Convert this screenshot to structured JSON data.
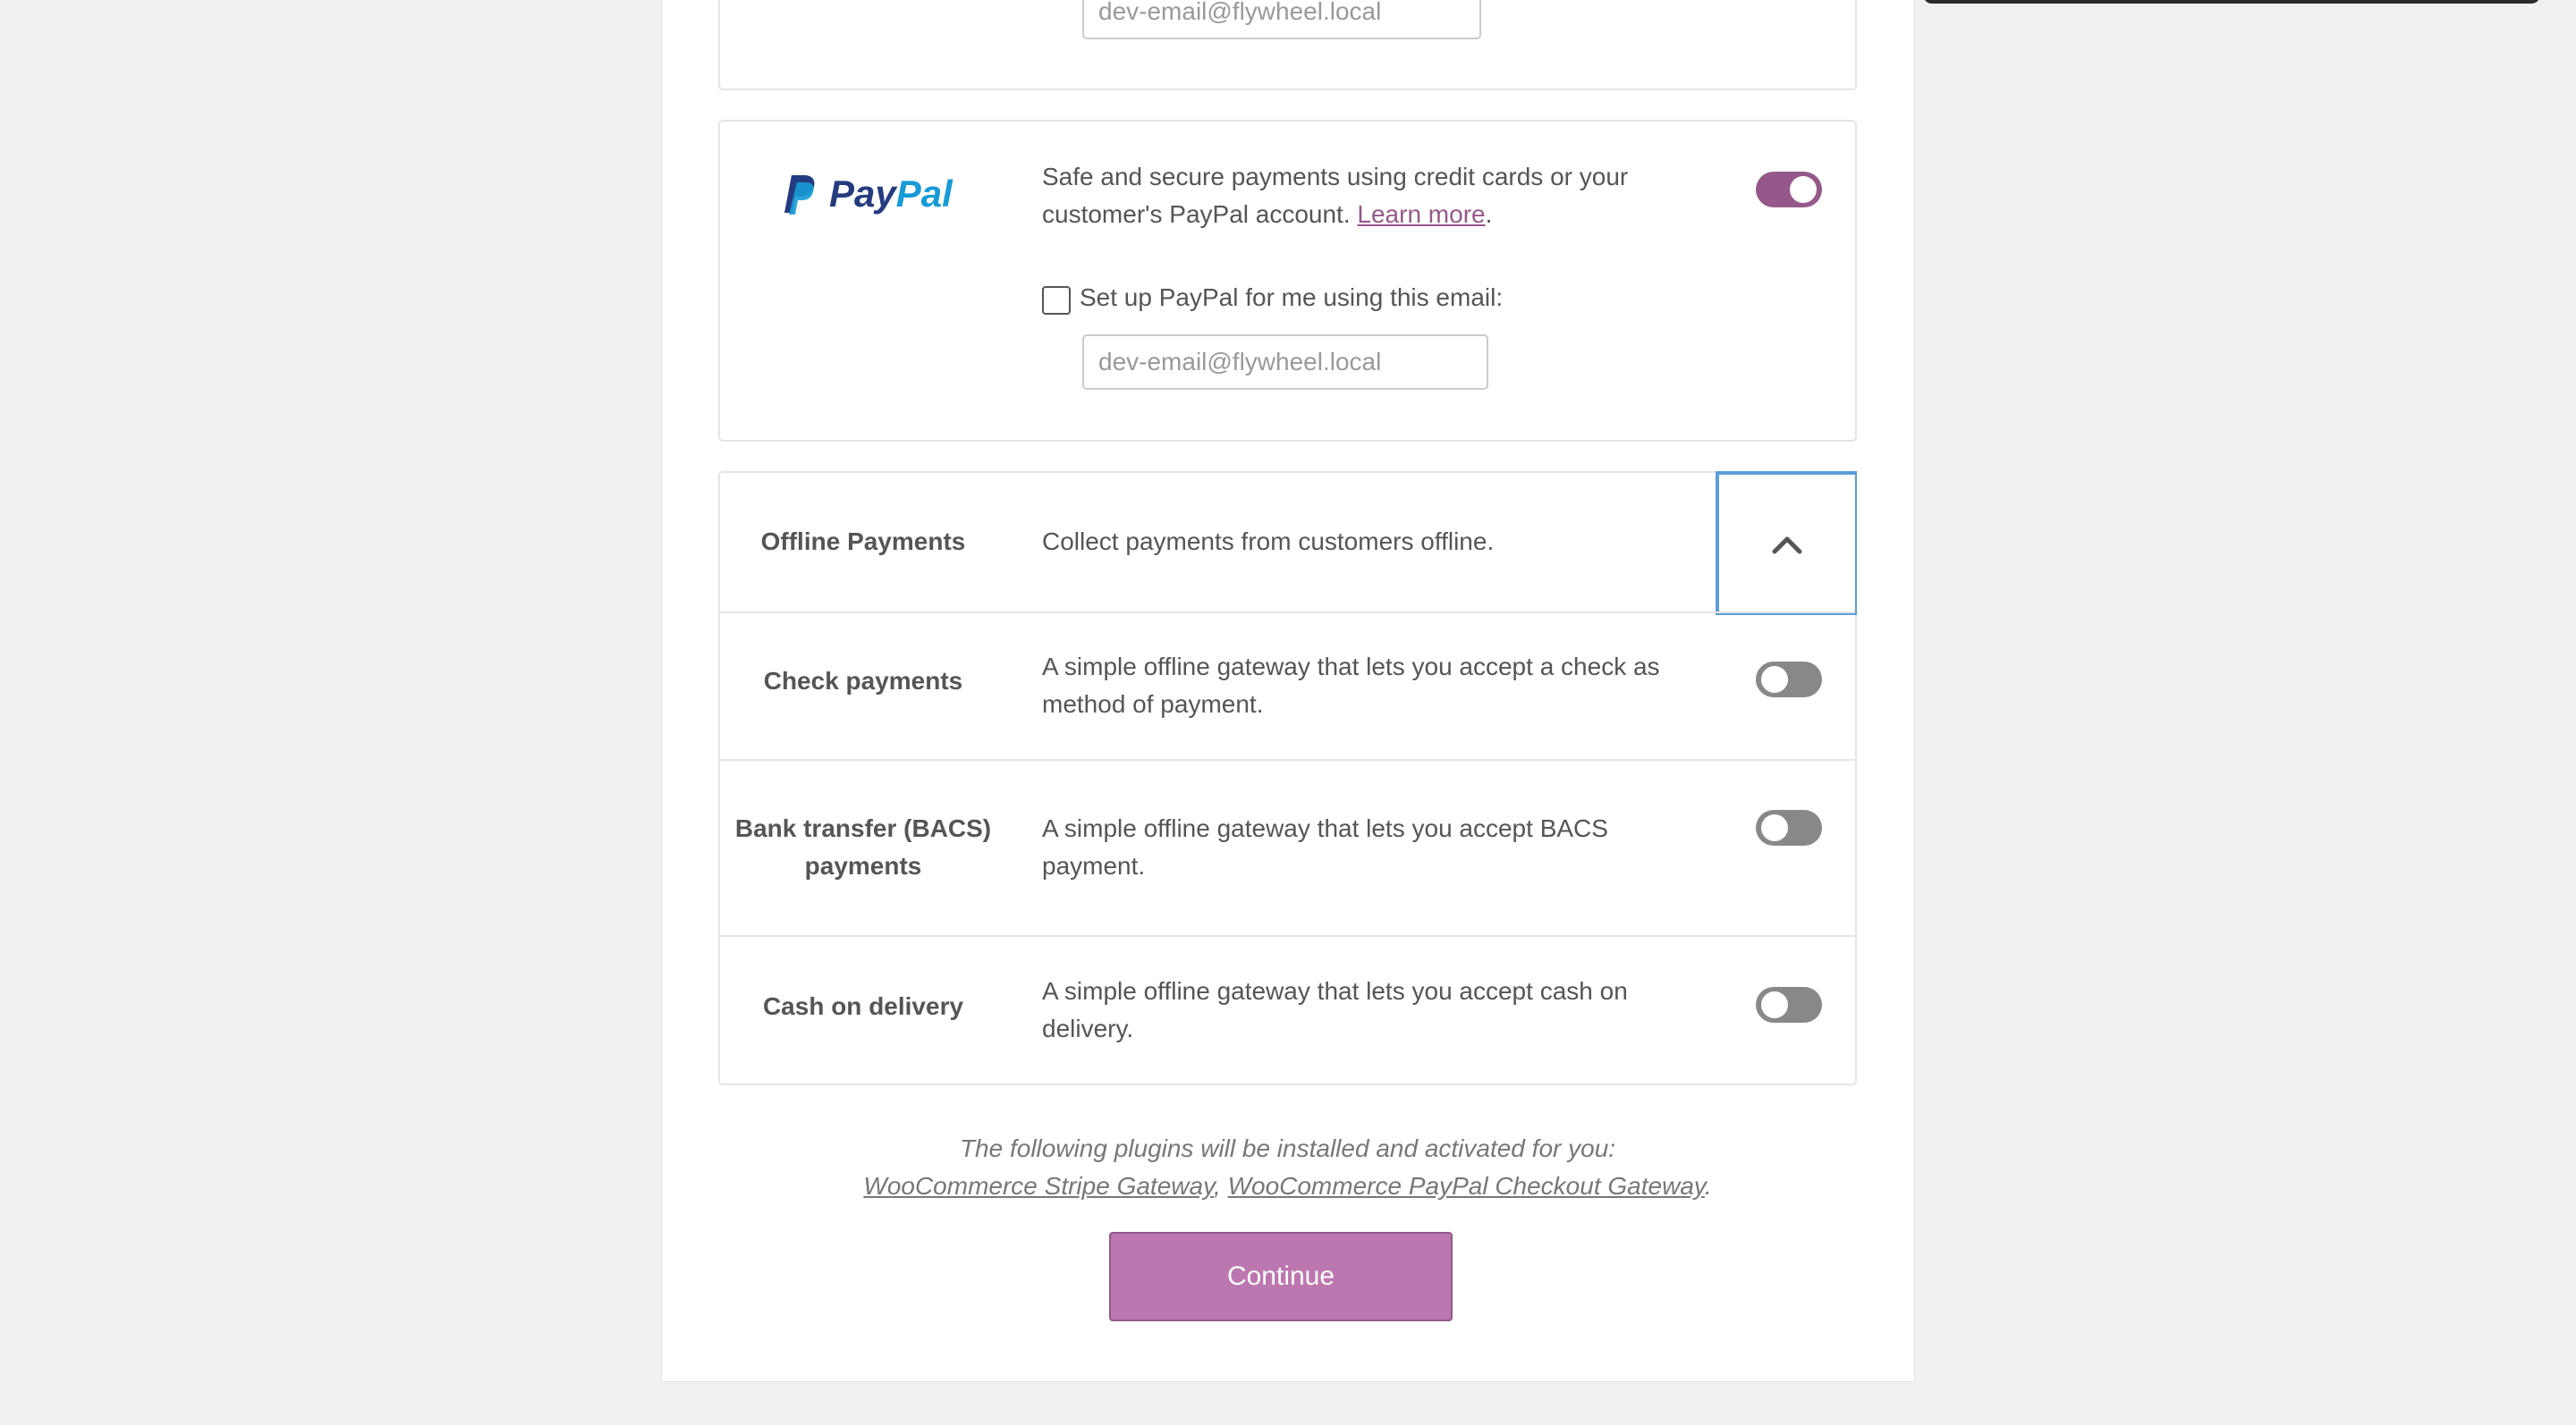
{
  "stripe": {
    "email_value": "dev-email@flywheel.local"
  },
  "paypal": {
    "logo_text_pay": "Pay",
    "logo_text_pal": "Pal",
    "logo_colors": {
      "dark": "#253B80",
      "light": "#179BD7"
    },
    "description": "Safe and secure payments using credit cards or your",
    "description_line2": "customer's PayPal account. ",
    "learn_more": "Learn more",
    "period": ".",
    "enabled": true,
    "setup_checkbox_label": "Set up PayPal for me using this email:",
    "setup_checked": false,
    "email_value": "dev-email@flywheel.local"
  },
  "offline": {
    "title": "Offline Payments",
    "description": "Collect payments from customers offline.",
    "collapse_icon": "chevron-up-icon",
    "methods": [
      {
        "title": "Check payments",
        "title_line2": "",
        "description": "A simple offline gateway that lets you accept a check as",
        "description_line2": "method of payment.",
        "enabled": false
      },
      {
        "title": "Bank transfer (BACS)",
        "title_line2": "payments",
        "description": "A simple offline gateway that lets you accept BACS",
        "description_line2": "payment.",
        "enabled": false
      },
      {
        "title": "Cash on delivery",
        "title_line2": "",
        "description": "A simple offline gateway that lets you accept cash on",
        "description_line2": "delivery.",
        "enabled": false
      }
    ]
  },
  "footer": {
    "note": "The following plugins will be installed and activated for you:",
    "plugin_1": "WooCommerce Stripe Gateway",
    "separator": ",",
    "plugin_2": "WooCommerce PayPal Checkout Gateway",
    "end": ".",
    "continue_label": "Continue"
  },
  "colors": {
    "accent": "#96588a",
    "button": "#bd77b0",
    "focus": "#5b9dd9"
  }
}
